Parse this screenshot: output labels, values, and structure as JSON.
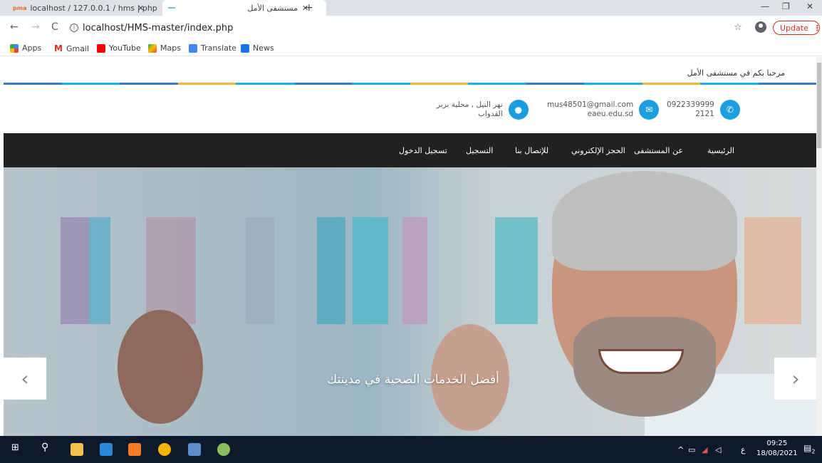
{
  "browser": {
    "tabs": [
      {
        "title": "localhost / 127.0.0.1 / hms | php",
        "favicon": "phpmyadmin-icon"
      },
      {
        "title": "مستشفى الأمل",
        "favicon": "site-icon"
      }
    ],
    "new_tab": "+",
    "url": "localhost/HMS-master/index.php",
    "update_label": "Update",
    "bookmarks": [
      "Apps",
      "Gmail",
      "YouTube",
      "Maps",
      "Translate",
      "News"
    ]
  },
  "page": {
    "welcome": "مرحبا بكم في مستشفى الأمل",
    "colorbar": [
      "#3a7bd5",
      "#1fb1e5",
      "#3a7bd5",
      "#f0b93b",
      "#1fb1e5",
      "#3a7bd5",
      "#1fb1e5",
      "#f0b93b",
      "#1fb1e5",
      "#3a7bd5",
      "#1fb1e5",
      "#f0b93b",
      "#1fb1e5",
      "#3a7bd5"
    ],
    "contact": {
      "phone_line1": "0922339999",
      "phone_line2": "2121",
      "email_line1": "mus48501@gmail.com",
      "email_line2": "eaeu.edu.sd",
      "address_line1": "نهر النيل , محلية بربر",
      "address_line2": "القدواب"
    },
    "nav": {
      "home": "الرئيسية",
      "about": "عن المستشفى",
      "booking": "الحجز الإلكتروني",
      "contact": "للإتصال بنا",
      "register": "التسجيل",
      "login": "تسجيل الدخول"
    },
    "hero": {
      "slogan": "أفضل الخدمات الصحية في مدينتك",
      "prev": "‹",
      "next": "›"
    }
  },
  "taskbar": {
    "time": "09:25",
    "date": "18/08/2021",
    "lang": "ع",
    "notifications": "2"
  },
  "colors": {
    "accent": "#1b9ee0",
    "navbar": "#212121",
    "update": "#d93025",
    "taskbar": "#0c1a2b"
  }
}
